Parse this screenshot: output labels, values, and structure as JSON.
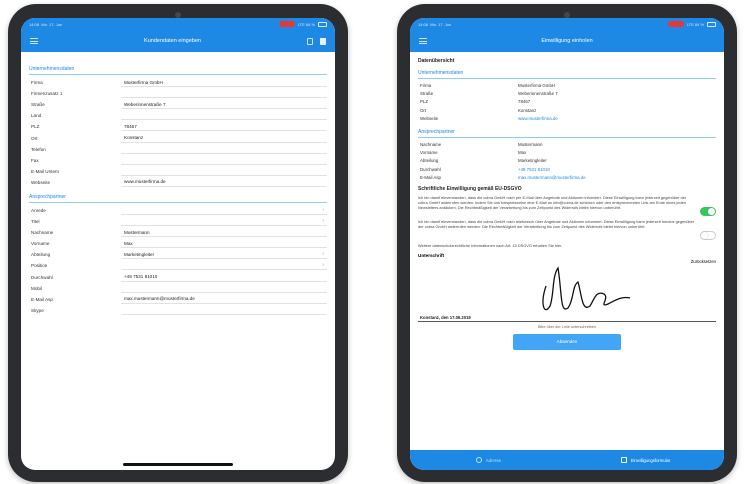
{
  "left": {
    "status": {
      "time": "14:08",
      "date": "Mo. 17. Jun",
      "signal": "LTE 84 %"
    },
    "nav": {
      "title": "Kundendaten eingeben"
    },
    "company_section": "Unternehmensdaten",
    "company_fields": [
      {
        "label": "Firma",
        "value": "Musterfirma GmbH"
      },
      {
        "label": "Firmenzusatz 1",
        "value": ""
      },
      {
        "label": "Straße",
        "value": "Weberinnenstraße 7"
      },
      {
        "label": "Land",
        "value": ""
      },
      {
        "label": "PLZ",
        "value": "78467"
      },
      {
        "label": "Ort",
        "value": "Konstanz"
      },
      {
        "label": "Telefon",
        "value": ""
      },
      {
        "label": "Fax",
        "value": ""
      },
      {
        "label": "E-Mail Untern",
        "value": ""
      },
      {
        "label": "Webseite",
        "value": "www.musterfirma.de"
      }
    ],
    "contact_section": "Ansprechpartner",
    "contact_fields": [
      {
        "label": "Anrede",
        "value": "",
        "chevron": "›"
      },
      {
        "label": "Titel",
        "value": "",
        "chevron": "›"
      },
      {
        "label": "Nachname",
        "value": "Mustermann",
        "chevron": ""
      },
      {
        "label": "Vorname",
        "value": "Max",
        "chevron": ""
      },
      {
        "label": "Abteilung",
        "value": "Marketingleiter",
        "chevron": "›"
      },
      {
        "label": "Position",
        "value": "",
        "chevron": "›"
      },
      {
        "label": "Durchwahl",
        "value": "+49 7531 81010",
        "chevron": ""
      },
      {
        "label": "Mobil",
        "value": "",
        "chevron": ""
      },
      {
        "label": "E-Mail Asp",
        "value": "max.mustermann@musterfirma.de",
        "chevron": ""
      },
      {
        "label": "Skype",
        "value": "",
        "chevron": ""
      }
    ]
  },
  "right": {
    "status": {
      "time": "14:08",
      "date": "Mo. 17. Jun",
      "signal": "LTE 84 %"
    },
    "nav": {
      "title": "Einwilligung einholen"
    },
    "overview_heading": "Datenübersicht",
    "company_section": "Unternehmensdaten",
    "company_rows": [
      {
        "label": "Firma",
        "value": "Musterfirma GmbH"
      },
      {
        "label": "Straße",
        "value": "Weberinnenstraße 7"
      },
      {
        "label": "PLZ",
        "value": "78467"
      },
      {
        "label": "Ort",
        "value": "Konstanz"
      },
      {
        "label": "Webseite",
        "value": "www.musterfirma.de"
      }
    ],
    "contact_section": "Ansprechpartner",
    "contact_rows": [
      {
        "label": "Nachname",
        "value": "Mustermann"
      },
      {
        "label": "Vorname",
        "value": "Max"
      },
      {
        "label": "Abteilung",
        "value": "Marketingleiter"
      },
      {
        "label": "Durchwahl",
        "value": "+49 7531 81010"
      },
      {
        "label": "E-Mail Asp",
        "value": "max.mustermann@musterfirma.de"
      }
    ],
    "consent_heading": "Schriftliche Einwilligung gemäß EU-DSGVO",
    "consent_email": {
      "text": "Ich bin damit einverstanden, dass die cobra GmbH mich per E-Mail über Angebote und Aktionen informiert. Diese Einwilligung kann jederzeit gegenüber der cobra GmbH widerrufen werden, indem Sie uns beispielsweise eine E-Mail an info@cobra.de schicken oder den entsprechenden Link am Ende eines jeden Newsletters anklicken. Die Rechtmäßigkeit der Verarbeitung bis zum Zeitpunkt des Widerrufs bleibt hiervon unberührt.",
      "enabled": true
    },
    "consent_phone": {
      "text": "Ich bin damit einverstanden, dass die cobra GmbH mich telefonisch über Angebote und Aktionen informiert. Diese Einwilligung kann jederzeit formlos gegenüber der cobra GmbH widerrufen werden. Die Rechtmäßigkeit der Verarbeitung bis zum Zeitpunkt des Widerrufs bleibt hiervon unberührt.",
      "enabled": false
    },
    "further_info": "Weitere datenschutzrechtliche Informationen nach Art. 13 DSGVO erhalten Sie hier.",
    "signature_heading": "Unterschrift",
    "reset_label": "Zurücksetzen",
    "signature_date": "Konstanz, den 17.06.2019",
    "signature_hint": "Bitte über der Linie unterschreiben",
    "send_label": "Absenden",
    "tabs": [
      {
        "label": "Adresse",
        "icon": "address-icon",
        "active": false
      },
      {
        "label": "Einwilligungsformular",
        "icon": "form-icon",
        "active": true
      }
    ]
  },
  "colors": {
    "primary": "#1e88e5",
    "toggle_on": "#34c759",
    "button": "#42a5f5"
  }
}
